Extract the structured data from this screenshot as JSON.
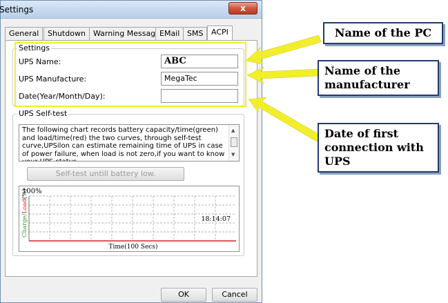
{
  "window": {
    "title": "Settings",
    "close_label": "x"
  },
  "tabs": [
    {
      "label": "General"
    },
    {
      "label": "Shutdown"
    },
    {
      "label": "Warning Message"
    },
    {
      "label": "EMail"
    },
    {
      "label": "SMS"
    },
    {
      "label": "ACPI"
    }
  ],
  "settings_group": {
    "legend": "Settings",
    "ups_name": {
      "label": "UPS Name:",
      "value": "ABC"
    },
    "ups_manufacture": {
      "label": "UPS Manufacture:",
      "value": "MegaTec"
    },
    "date": {
      "label": "Date(Year/Month/Day):",
      "value": ""
    }
  },
  "selftest_group": {
    "legend": "UPS Self-test",
    "description": "The following chart records battery capacity/time(green) and load/time(red) the two curves, through self-test curve,UPSilon can estimate remaining time of UPS in case of power failure, when load is not zero,if you want to know your UPS status,",
    "button_label": "Self-test untill battery low.",
    "chart": {
      "top_label": "100%",
      "y_axis_label_charge": "Charge/",
      "y_axis_label_load": "Load",
      "y_axis_label_unit": "(%)",
      "time_label": "18:14:07",
      "x_axis_label": "Time(100 Secs)"
    }
  },
  "buttons": {
    "ok": "OK",
    "cancel": "Cancel"
  },
  "annotations": {
    "pc_name": "Name of the PC",
    "manufacturer_line1": "Name of the",
    "manufacturer_line2": "manufacturer",
    "date_line1": "Date of first",
    "date_line2": "connection with",
    "date_line3": "UPS"
  },
  "colors": {
    "highlight_box": "#f2ee2a",
    "arrow": "#f2ee2a",
    "load_line": "#d42020",
    "charge_axis_label": "#2a9a2a",
    "load_axis_label": "#d42020"
  }
}
